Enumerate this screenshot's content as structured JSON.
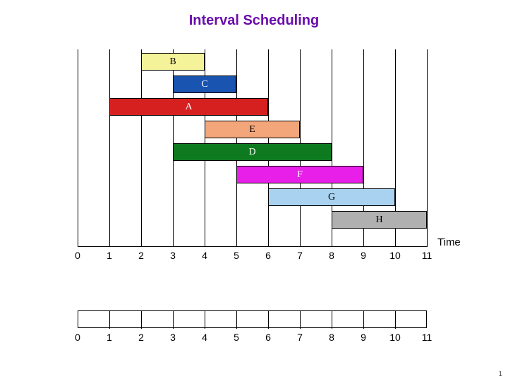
{
  "title": "Interval Scheduling",
  "axis_label": "Time",
  "slide_number": "1",
  "chart_data": {
    "type": "bar",
    "title": "Interval Scheduling",
    "xlabel": "Time",
    "ylabel": "",
    "xlim": [
      0,
      11
    ],
    "ticks": [
      0,
      1,
      2,
      3,
      4,
      5,
      6,
      7,
      8,
      9,
      10,
      11
    ],
    "intervals": [
      {
        "name": "B",
        "start": 2,
        "end": 4,
        "row": 0,
        "fill": "#f5f39a",
        "text": "#000000"
      },
      {
        "name": "C",
        "start": 3,
        "end": 5,
        "row": 1,
        "fill": "#1954b0",
        "text": "#ffffff"
      },
      {
        "name": "A",
        "start": 1,
        "end": 6,
        "row": 2,
        "fill": "#d61f1f",
        "text": "#ffffff"
      },
      {
        "name": "E",
        "start": 4,
        "end": 7,
        "row": 3,
        "fill": "#f2a679",
        "text": "#000000"
      },
      {
        "name": "D",
        "start": 3,
        "end": 8,
        "row": 4,
        "fill": "#0e7a1f",
        "text": "#ffffff"
      },
      {
        "name": "F",
        "start": 5,
        "end": 9,
        "row": 5,
        "fill": "#e81fe8",
        "text": "#ffffff"
      },
      {
        "name": "G",
        "start": 6,
        "end": 10,
        "row": 6,
        "fill": "#a9d2f0",
        "text": "#000000"
      },
      {
        "name": "H",
        "start": 8,
        "end": 11,
        "row": 7,
        "fill": "#b0b0b0",
        "text": "#000000"
      }
    ],
    "lower_ticks": [
      0,
      1,
      2,
      3,
      4,
      5,
      6,
      7,
      8,
      9,
      10,
      11
    ]
  }
}
